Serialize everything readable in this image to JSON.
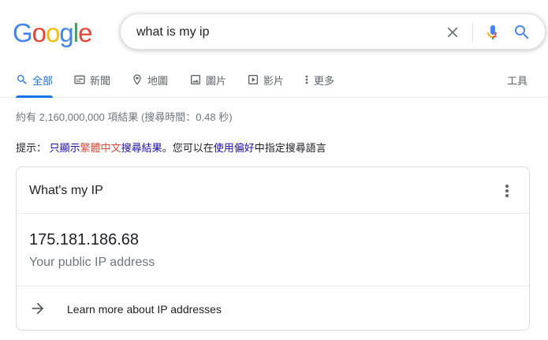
{
  "logo": {
    "letters": [
      "G",
      "o",
      "o",
      "g",
      "l",
      "e"
    ],
    "colors": [
      "#4285F4",
      "#EA4335",
      "#FBBC05",
      "#4285F4",
      "#34A853",
      "#EA4335"
    ]
  },
  "search": {
    "query": "what is my ip"
  },
  "tabs": {
    "all": "全部",
    "news": "新聞",
    "maps": "地圖",
    "images": "圖片",
    "videos": "影片",
    "more": "更多",
    "tools": "工具"
  },
  "stats": "約有 2,160,000,000 項結果 (搜尋時間：0.48 秒)",
  "hint": {
    "prefix": "提示：",
    "part1": "只顯示",
    "part2": "繁體中文",
    "part3": "搜尋結果",
    "part4": "。您可以在",
    "part5": "使用偏好",
    "part6": "中指定搜尋語言"
  },
  "card": {
    "title": "What's my IP",
    "ip": "175.181.186.68",
    "ip_label": "Your public IP address",
    "learn_more": "Learn more about IP addresses"
  },
  "colors": {
    "accent": "#1a73e8",
    "link": "#1a0dab",
    "highlight": "#dd4b39"
  }
}
